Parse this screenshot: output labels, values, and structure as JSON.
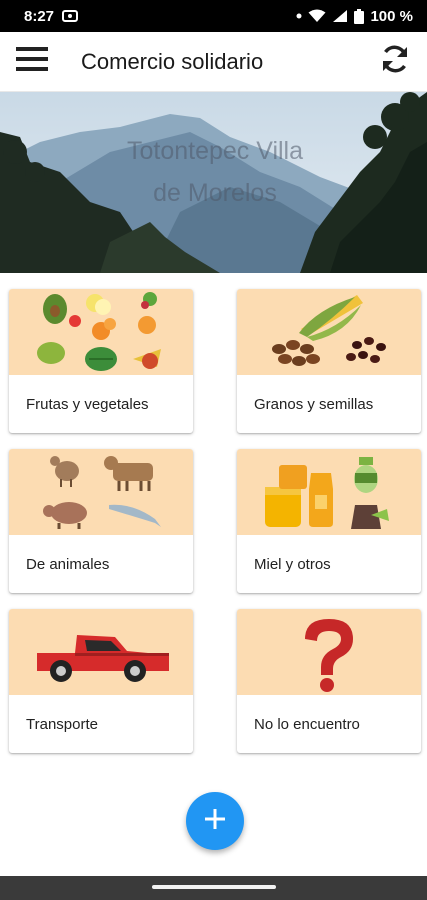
{
  "status_bar": {
    "time": "8:27",
    "battery": "100 %"
  },
  "app_bar": {
    "title": "Comercio solidario"
  },
  "banner": {
    "line1": "Totontepec Villa",
    "line2": "de Morelos"
  },
  "categories": [
    {
      "label": "Frutas y vegetales"
    },
    {
      "label": "Granos y semillas"
    },
    {
      "label": "De animales"
    },
    {
      "label": "Miel y otros"
    },
    {
      "label": "Transporte"
    },
    {
      "label": "No lo encuentro"
    }
  ],
  "colors": {
    "accent": "#2196f3",
    "card_image_bg": "#fcdcb2"
  },
  "icons": {
    "menu": "hamburger-icon",
    "refresh": "refresh-icon",
    "fab": "plus-icon"
  }
}
